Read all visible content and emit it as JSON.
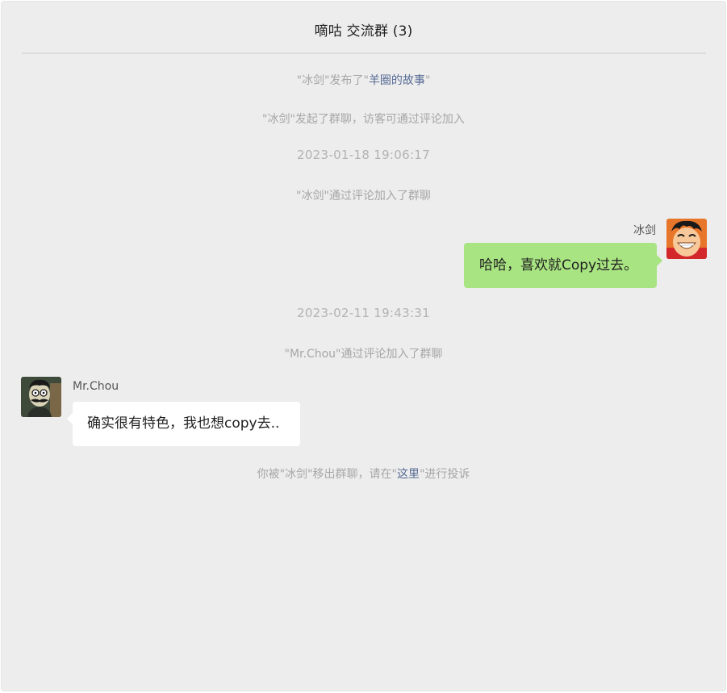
{
  "header": {
    "title": "嘀咕 交流群 (3)"
  },
  "events": {
    "published_prefix": "\"冰剑\"发布了\"",
    "published_link": "羊圈的故事",
    "published_suffix": "\"",
    "started_group": "\"冰剑\"发起了群聊，访客可通过评论加入",
    "timestamp_1": "2023-01-18 19:06:17",
    "joined_bingjian": "\"冰剑\"通过评论加入了群聊",
    "timestamp_2": "2023-02-11 19:43:31",
    "joined_mrchou": "\"Mr.Chou\"通过评论加入了群聊",
    "removed_prefix": "你被\"冰剑\"移出群聊，请在\"",
    "removed_link": "这里",
    "removed_suffix": "\"进行投诉"
  },
  "messages": [
    {
      "sender": "冰剑",
      "side": "right",
      "text": "哈哈，喜欢就Copy过去。",
      "avatar": "luffy-avatar-icon"
    },
    {
      "sender": "Mr.Chou",
      "side": "left",
      "text": "确实很有特色，我也想copy去..",
      "avatar": "mustache-man-avatar-icon"
    }
  ],
  "colors": {
    "background": "#ededed",
    "self_bubble": "#a9e482",
    "other_bubble": "#ffffff",
    "system_text": "#a6a6a6",
    "link": "#576b95"
  }
}
